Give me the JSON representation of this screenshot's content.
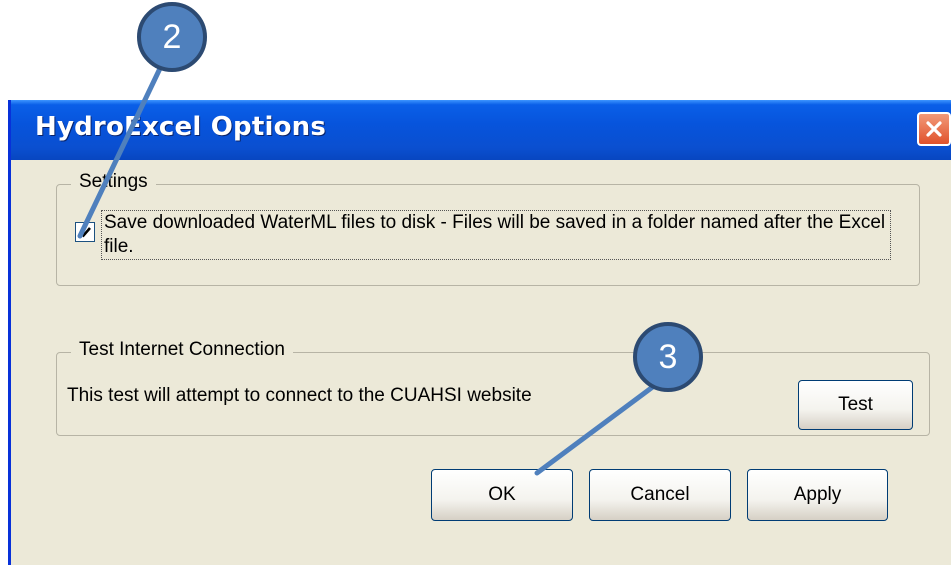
{
  "window": {
    "title": "HydroExcel Options",
    "close_icon": "close-icon"
  },
  "settings": {
    "legend": "Settings",
    "checkbox_checked": true,
    "checkbox_label": "Save downloaded WaterML files to disk - Files will be saved in a folder named after the Excel file."
  },
  "test_connection": {
    "legend": "Test Internet Connection",
    "description": "This test will attempt to connect to the CUAHSI website",
    "test_label": "Test"
  },
  "buttons": {
    "ok_label": "OK",
    "cancel_label": "Cancel",
    "apply_label": "Apply"
  },
  "annotations": {
    "step_2": "2",
    "step_3": "3",
    "color": "#4f80bd"
  },
  "colors": {
    "titlebar": "#0754dc",
    "dialog_bg": "#ece9d8",
    "close_button": "#e0512b"
  }
}
